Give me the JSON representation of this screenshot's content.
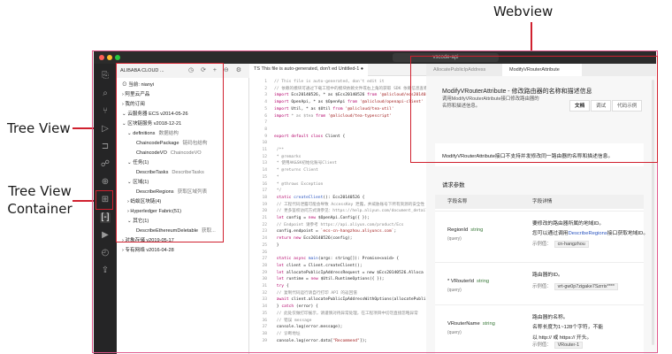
{
  "annotations": {
    "webview": "Webview",
    "tree_view": "Tree View",
    "tree_view_container_line1": "Tree View",
    "tree_view_container_line2": "Container"
  },
  "window": {
    "address": "vscode-api"
  },
  "sidebar": {
    "title": "ALIBABA CLOUD ...",
    "tools": "◷ ⟳ + ⊖ ⚙",
    "items": [
      {
        "text": "⊙ 当前: nianyi",
        "muted": ""
      },
      {
        "text": "› 阿里云产品",
        "muted": ""
      },
      {
        "text": "› 我的订阅",
        "muted": ""
      },
      {
        "text": "⌄ 云服务器 ECS v2014-05-26",
        "muted": ""
      },
      {
        "text": "⌄ 区块链服务 v2018-12-21",
        "muted": ""
      },
      {
        "text": "⌄ definitions",
        "muted": "数据结构"
      },
      {
        "text": "ChaincodePackage",
        "muted": "链码包结构"
      },
      {
        "text": "ChaincodeVO",
        "muted": "ChaincodeVO"
      },
      {
        "text": "⌄ 任务(1)",
        "muted": ""
      },
      {
        "text": "DescribeTasks",
        "muted": "DescribeTasks"
      },
      {
        "text": "⌄ 区域(1)",
        "muted": ""
      },
      {
        "text": "DescribeRegions",
        "muted": "获取区域列表"
      },
      {
        "text": "› 蚂蚁区块链(4)",
        "muted": ""
      },
      {
        "text": "› Hyperledger Fabric(51)",
        "muted": ""
      },
      {
        "text": "⌄ 其它(1)",
        "muted": ""
      },
      {
        "text": "DescribeEthereumDeletable",
        "muted": "获取..."
      },
      {
        "text": "› 对象存储 v2019-05-17",
        "muted": ""
      },
      {
        "text": "› 专有网络 v2016-04-28",
        "muted": ""
      }
    ]
  },
  "editor": {
    "tab_label": "TS This file is auto-generated, don't ed Untitled-1 ●",
    "lines": [
      [
        {
          "t": "// This file is auto-generated, don't edit it",
          "c": "com"
        }
      ],
      [
        {
          "t": "// 依赖的模块可通过下载工程中的模块依赖文件或右上角的获取 SDK 依赖信息查看",
          "c": "com"
        }
      ],
      [
        {
          "t": "import ",
          "c": "kw"
        },
        {
          "t": "Ecs20140526",
          "c": "plain"
        },
        {
          "t": ", * as $Ecs20140526 ",
          "c": "plain"
        },
        {
          "t": "from ",
          "c": "kw"
        },
        {
          "t": "'@alicloud/ecs20140526'",
          "c": "str"
        }
      ],
      [
        {
          "t": "import ",
          "c": "kw"
        },
        {
          "t": "OpenApi, * as $OpenApi ",
          "c": "plain"
        },
        {
          "t": "from ",
          "c": "kw"
        },
        {
          "t": "'@alicloud/openapi-client'",
          "c": "str"
        }
      ],
      [
        {
          "t": "import ",
          "c": "kw"
        },
        {
          "t": "Util, * as $Util ",
          "c": "plain"
        },
        {
          "t": "from ",
          "c": "kw"
        },
        {
          "t": "'@alicloud/tea-util'",
          "c": "str"
        }
      ],
      [
        {
          "t": "import ",
          "c": "kw"
        },
        {
          "t": "* as $tea ",
          "c": "com"
        },
        {
          "t": "from ",
          "c": "kw"
        },
        {
          "t": "'@alicloud/tea-typescript'",
          "c": "str"
        }
      ],
      [
        {
          "t": "",
          "c": "plain"
        }
      ],
      [
        {
          "t": "",
          "c": "plain"
        }
      ],
      [
        {
          "t": "export default class ",
          "c": "kw"
        },
        {
          "t": "Client {",
          "c": "plain"
        }
      ],
      [
        {
          "t": "",
          "c": "plain"
        }
      ],
      [
        {
          "t": "  /**",
          "c": "com"
        }
      ],
      [
        {
          "t": "   * @remarks",
          "c": "com"
        }
      ],
      [
        {
          "t": "   * 使用AK&SK初始化账号Client",
          "c": "com"
        }
      ],
      [
        {
          "t": "   * @returns Client",
          "c": "com"
        }
      ],
      [
        {
          "t": "   *",
          "c": "com"
        }
      ],
      [
        {
          "t": "   * @throws Exception",
          "c": "com"
        }
      ],
      [
        {
          "t": "   */",
          "c": "com"
        }
      ],
      [
        {
          "t": "  static ",
          "c": "kw"
        },
        {
          "t": "createClient",
          "c": "fn"
        },
        {
          "t": "(): Ecs20140526 {",
          "c": "plain"
        }
      ],
      [
        {
          "t": "    // 工程代码泄露可能会导致 AccessKey 泄露，并威胁账号下所有资源的安全性",
          "c": "com"
        }
      ],
      [
        {
          "t": "    // 更多鉴权访问方式请参见：https://help.aliyun.com/document_detail",
          "c": "com"
        }
      ],
      [
        {
          "t": "    let ",
          "c": "kw"
        },
        {
          "t": "config = ",
          "c": "plain"
        },
        {
          "t": "new ",
          "c": "kw"
        },
        {
          "t": "$OpenApi.Config({ });",
          "c": "plain"
        }
      ],
      [
        {
          "t": "    // Endpoint 请参考 https://api.aliyun.com/product/Ecs",
          "c": "com"
        }
      ],
      [
        {
          "t": "    config.endpoint = ",
          "c": "plain"
        },
        {
          "t": "`ecs-cn-hangzhou.aliyuncs.com`",
          "c": "str"
        },
        {
          "t": ";",
          "c": "plain"
        }
      ],
      [
        {
          "t": "    return new ",
          "c": "kw"
        },
        {
          "t": "Ecs20140526(config);",
          "c": "plain"
        }
      ],
      [
        {
          "t": "  }",
          "c": "plain"
        }
      ],
      [
        {
          "t": "",
          "c": "plain"
        }
      ],
      [
        {
          "t": "  static async ",
          "c": "kw"
        },
        {
          "t": "main",
          "c": "fn"
        },
        {
          "t": "(args: string[]): Promise<void> {",
          "c": "plain"
        }
      ],
      [
        {
          "t": "    let ",
          "c": "kw"
        },
        {
          "t": "client = Client.createClient();",
          "c": "plain"
        }
      ],
      [
        {
          "t": "    let ",
          "c": "kw"
        },
        {
          "t": "allocatePublicIpAddressRequest = new $Ecs20140526.Alloca",
          "c": "plain"
        }
      ],
      [
        {
          "t": "    let ",
          "c": "kw"
        },
        {
          "t": "runtime = ",
          "c": "plain"
        },
        {
          "t": "new ",
          "c": "kw"
        },
        {
          "t": "$Util.RuntimeOptions({ });",
          "c": "plain"
        }
      ],
      [
        {
          "t": "    try ",
          "c": "kw"
        },
        {
          "t": "{",
          "c": "plain"
        }
      ],
      [
        {
          "t": "      // 复制代码运行请自行打印 API 的返回值",
          "c": "com"
        }
      ],
      [
        {
          "t": "      await ",
          "c": "kw"
        },
        {
          "t": "client.allocatePublicIpAddressWithOptions(allocatePubli",
          "c": "plain"
        }
      ],
      [
        {
          "t": "    } ",
          "c": "plain"
        },
        {
          "t": "catch ",
          "c": "kw"
        },
        {
          "t": "(error) {",
          "c": "plain"
        }
      ],
      [
        {
          "t": "      // 此处仅做打印展示，请谨慎对待异常处理，在工程项目中切勿直接忽略异常",
          "c": "com"
        }
      ],
      [
        {
          "t": "      // 错误 message",
          "c": "com"
        }
      ],
      [
        {
          "t": "      console.log(error.message);",
          "c": "plain"
        }
      ],
      [
        {
          "t": "      // 诊断地址",
          "c": "com"
        }
      ],
      [
        {
          "t": "      console.log(error.data[",
          "c": "plain"
        },
        {
          "t": "\"Recommend\"",
          "c": "str"
        },
        {
          "t": "]);",
          "c": "plain"
        }
      ]
    ]
  },
  "webview": {
    "tab1": "AllocatePublicIpAddress",
    "tab2": "ModifyVRouterAttribute",
    "title": "ModifyVRouterAttribute - 修改路由器的名称和描述信息",
    "subtitle": "调用ModifyVRouterAttribute接口修改路由器的名称和描述信息。",
    "seg_doc": "文档",
    "seg_debug": "调试",
    "seg_sample": "代码示例",
    "notice": "ModifyVRouterAttribute接口不支持并发修改同一路由器的名称和描述信息。",
    "section": "请求参数",
    "col_name": "字段名称",
    "col_detail": "字段详情",
    "params": [
      {
        "name": "RegionId",
        "type": "string",
        "query": "(query)",
        "desc1": "要修改的路由器所属的地域ID。",
        "desc2_pre": "您可以通过调用",
        "desc2_link": "DescribeRegions",
        "desc2_post": "接口获取地域ID。",
        "example_label": "示例值：",
        "example": "cn-hangzhou"
      },
      {
        "name": "* VRouterId",
        "type": "string",
        "query": "(query)",
        "desc1": "路由器的ID。",
        "desc2_pre": "",
        "desc2_link": "",
        "desc2_post": "",
        "example_label": "示例值：",
        "example": "vrt-gw0p7zigake7Szrrix****"
      },
      {
        "name": "VRouterName",
        "type": "string",
        "query": "(query)",
        "desc1": "路由器的名称。",
        "desc2_pre": "名称长度为1~128个字符，不能",
        "desc2_link": "",
        "desc2_post": "以 http:// 或 https:// 开头。",
        "example_label": "示例值：",
        "example": "VRouter-1"
      }
    ]
  }
}
